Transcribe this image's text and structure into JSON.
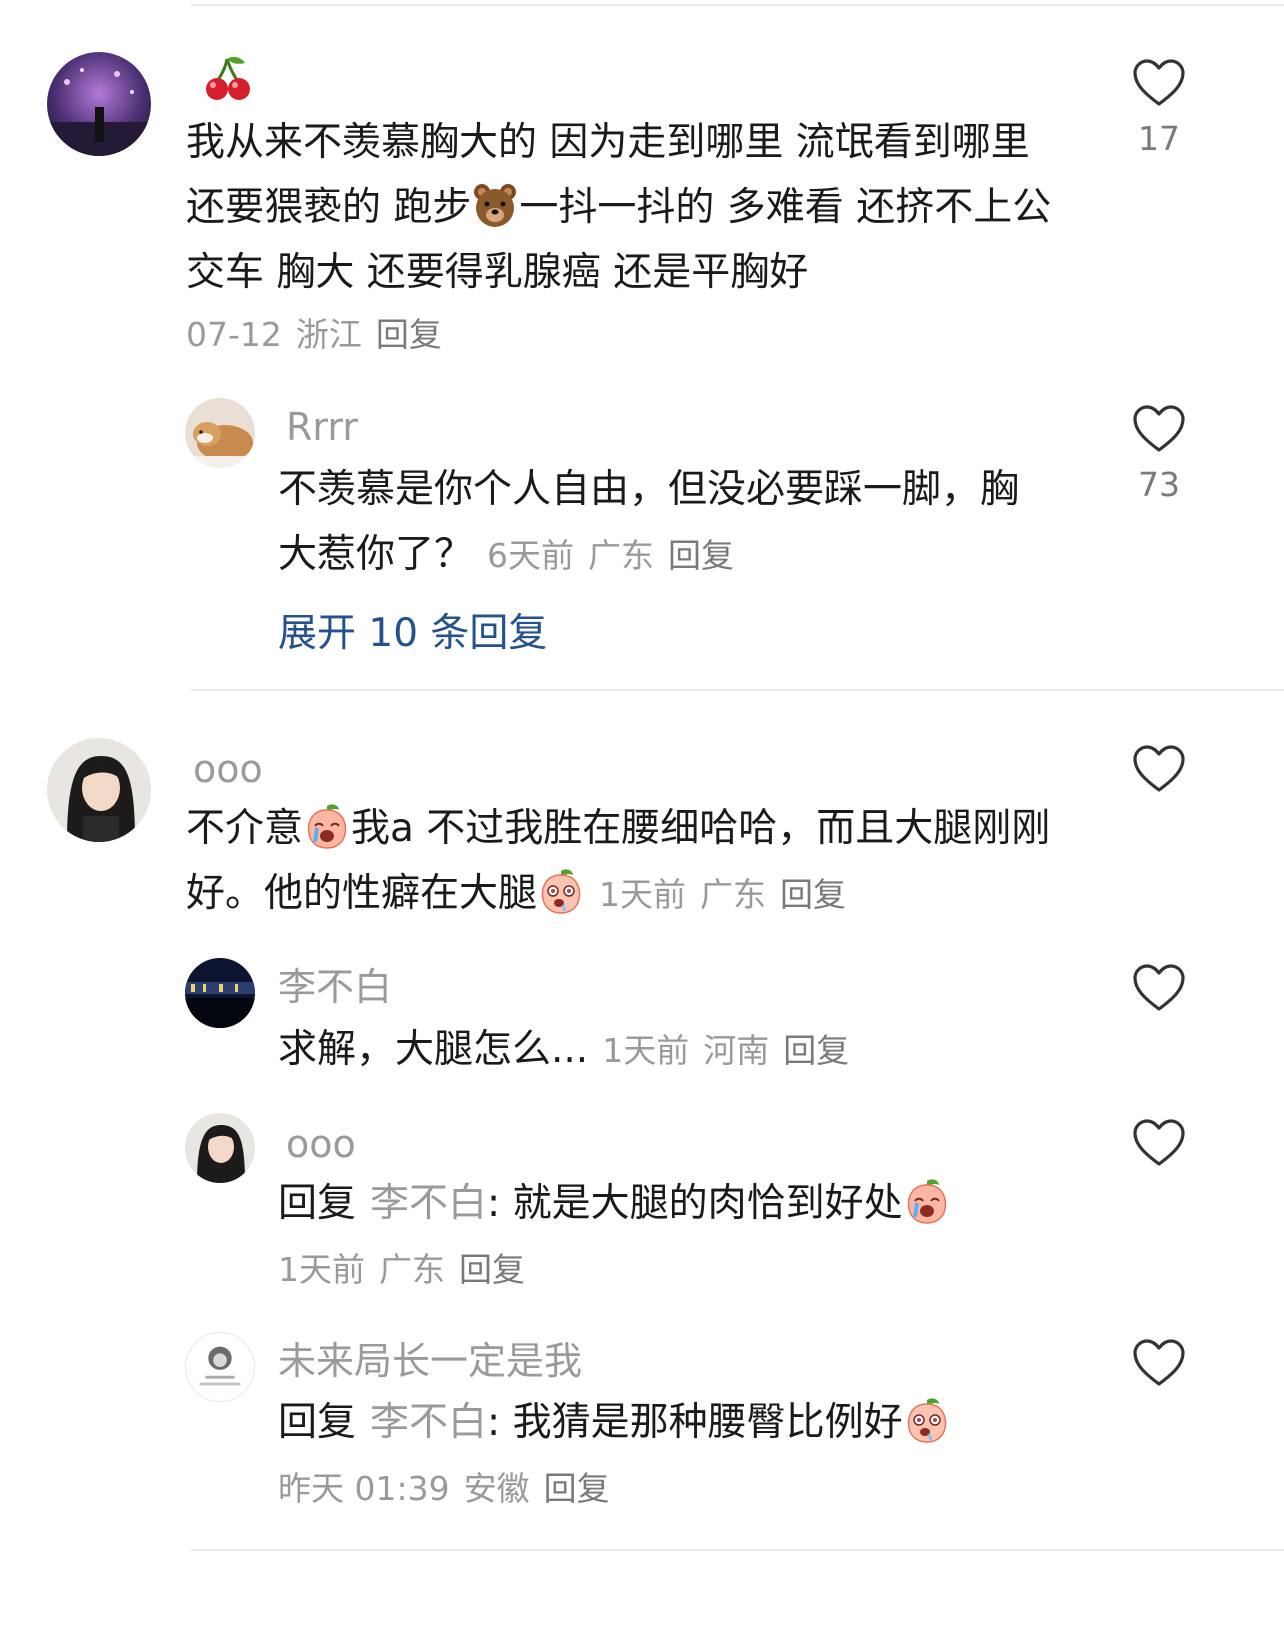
{
  "comments": [
    {
      "name": "",
      "text_line1": "我从来不羡慕胸大的 因为走到哪里 流氓看到哪里",
      "text_line2a": "还要猥亵的 跑步",
      "text_line2b": "一抖一抖的 多难看 还挤不上公",
      "text_line3": "交车 胸大 还要得乳腺癌 还是平胸好",
      "date": "07-12",
      "location": "浙江",
      "reply_label": "回复",
      "likes": "17",
      "icons": [
        "cherry-icon",
        "bear-icon"
      ]
    },
    {
      "name": "Rrrr",
      "text_line1": "不羡慕是你个人自由，但没必要踩一脚，胸",
      "text_line2": "大惹你了？",
      "date": "6天前",
      "location": "广东",
      "reply_label": "回复",
      "likes": "73"
    },
    {
      "expand_label": "展开 10 条回复"
    },
    {
      "name": "ooo",
      "text_line1a": "不介意",
      "text_line1b": "我a 不过我胜在腰细哈哈，而且大腿刚刚",
      "text_line2": "好。他的性癖在大腿",
      "date": "1天前",
      "location": "广东",
      "reply_label": "回复",
      "icons": [
        "crying-peach-icon",
        "drooling-peach-icon"
      ]
    },
    {
      "name": "李不白",
      "text": "求解，大腿怎么...",
      "date": "1天前",
      "location": "河南",
      "reply_label": "回复"
    },
    {
      "name": "ooo",
      "prefix": "回复",
      "quoted": "李不白",
      "text": ": 就是大腿的肉恰到好处",
      "date": "1天前",
      "location": "广东",
      "reply_label": "回复",
      "icons": [
        "crying-peach-icon"
      ]
    },
    {
      "name": "未来局长一定是我",
      "prefix": "回复",
      "quoted": "李不白",
      "text": ": 我猜是那种腰臀比例好",
      "date": "昨天 01:39",
      "location": "安徽",
      "reply_label": "回复",
      "icons": [
        "drooling-peach-icon"
      ]
    }
  ],
  "colors": {
    "text": "#1a1a1a",
    "muted": "#9a9a9a",
    "link": "#24528f",
    "divider": "#ececec"
  }
}
